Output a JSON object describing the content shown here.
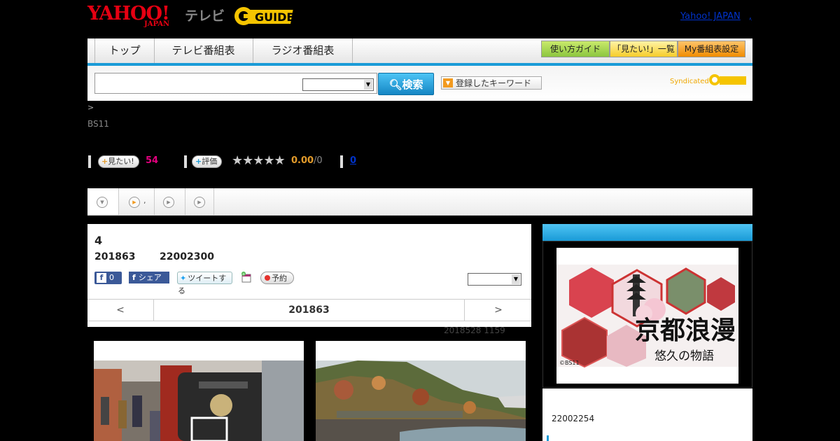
{
  "header": {
    "logo_yahoo": "YAHOO!",
    "logo_japan": "JAPAN",
    "logo_tv": "テレビ",
    "logo_gguide": "GUIDE",
    "yahoo_link": "Yahoo! JAPAN",
    "link_sep": ","
  },
  "nav": {
    "tabs": [
      "トップ",
      "テレビ番組表",
      "ラジオ番組表"
    ],
    "guide_buttons": [
      "使い方ガイド",
      "「見たい!」一覧",
      "My番組表設定"
    ]
  },
  "search": {
    "button": "検索",
    "keyword_button": "登録したキーワード",
    "syndicated": "Syndicated",
    "select_value": ""
  },
  "breadcrumb": ">",
  "channel": "BS11",
  "actions": {
    "want_label": "見たい!",
    "want_count": "54",
    "rate_label": "評価",
    "stars": "★★★★★",
    "score": "0.00",
    "score_total": "/0",
    "link_count": "0"
  },
  "playtabs": [
    ",",
    "",
    ""
  ],
  "program": {
    "title": "4",
    "date": "201863",
    "time_code": "22002300",
    "fb_like_count": "0",
    "fb_share": "シェア",
    "tweet": "ツイートする",
    "record": "予約",
    "select_value": ""
  },
  "pager": {
    "prev": "<",
    "current": "201863",
    "next": ">"
  },
  "updated": "2018528  1159",
  "poster": {
    "title_main": "京都浪漫",
    "title_sub": "悠久の物語",
    "copyright": "©BS11"
  },
  "sidebar": {
    "code": "22002254"
  },
  "colors": {
    "accent_blue": "#1a9bd7",
    "yahoo_red": "#e60012",
    "pink_count": "#e4007f",
    "score_orange": "#e39b2a"
  }
}
